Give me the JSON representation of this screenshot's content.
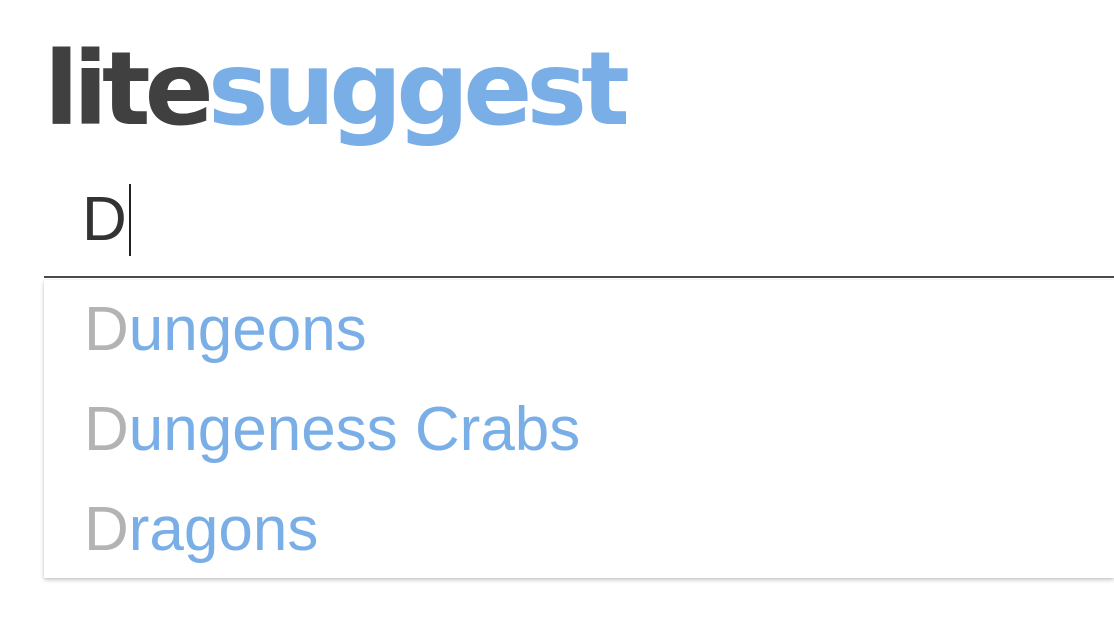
{
  "logo": {
    "part1": "lite",
    "part2": "suggest",
    "color_part1": "#404040",
    "color_part2": "#7aaee6"
  },
  "search": {
    "value": "D"
  },
  "suggestions": [
    {
      "match": "D",
      "rest": "ungeons"
    },
    {
      "match": "D",
      "rest": "ungeness Crabs"
    },
    {
      "match": "D",
      "rest": "ragons"
    }
  ],
  "colors": {
    "match_text": "#b3b3b3",
    "suggestion_text": "#7aaee6",
    "input_border": "#4a4a4a"
  }
}
